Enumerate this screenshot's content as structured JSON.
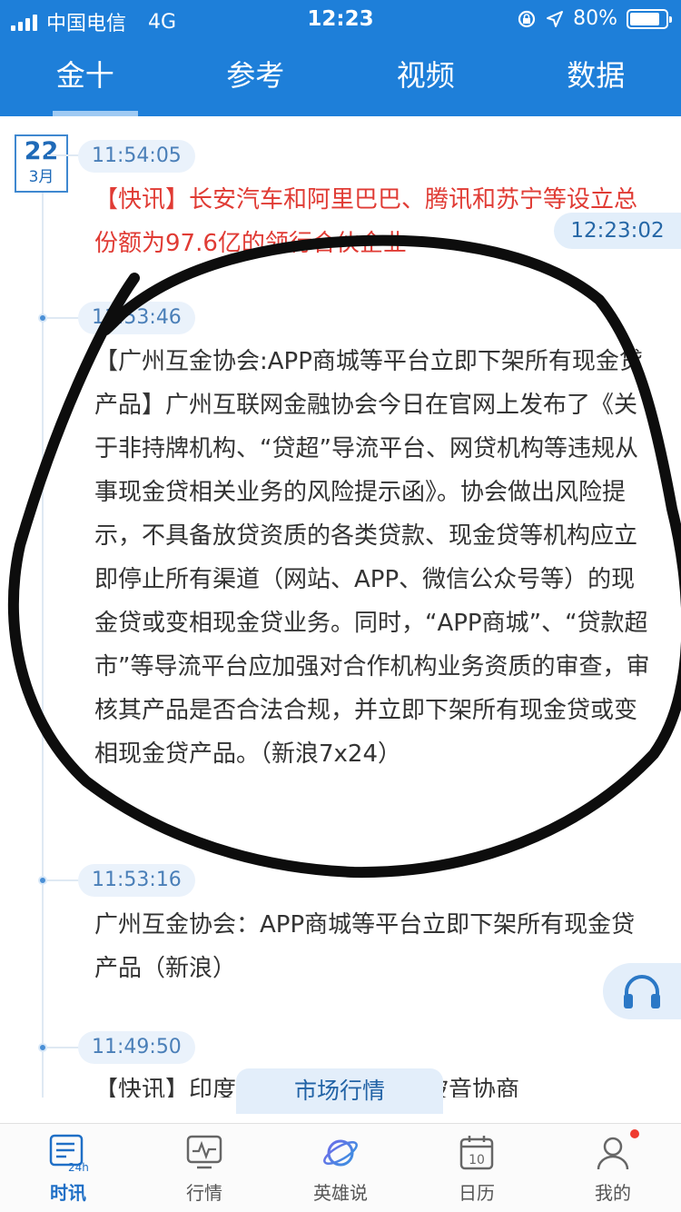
{
  "status_bar": {
    "carrier": "中国电信",
    "network": "4G",
    "time": "12:23",
    "battery": "80%"
  },
  "top_tabs": [
    {
      "label": "金十",
      "active": true
    },
    {
      "label": "参考",
      "active": false
    },
    {
      "label": "视频",
      "active": false
    },
    {
      "label": "数据",
      "active": false
    }
  ],
  "date": {
    "day": "22",
    "month": "3月"
  },
  "floating_time": "12:23:02",
  "news": [
    {
      "time": "11:54:05",
      "text": "【快讯】长安汽车和阿里巴巴、腾讯和苏宁等设立总份额为97.6亿的领行合伙企业",
      "highlight": true
    },
    {
      "time": "11:53:46",
      "text": "【广州互金协会:APP商城等平台立即下架所有现金贷产品】广州互联网金融协会今日在官网上发布了《关于非持牌机构、“贷超”导流平台、网贷机构等违规从事现金贷相关业务的风险提示函》。协会做出风险提示，不具备放贷资质的各类贷款、现金贷等机构应立即停止所有渠道（网站、APP、微信公众号等）的现金贷或变相现金贷业务。同时，“APP商城”、“贷款超市”等导流平台应加强对合作机构业务资质的审查，审核其产品是否合法合规，并立即下架所有现金贷或变相现金贷产品。（新浪7x24）",
      "highlight": false
    },
    {
      "time": "11:53:16",
      "text": "广州互金协会：APP商城等平台立即下架所有现金贷产品（新浪）",
      "highlight": false
    },
    {
      "time": "11:49:50",
      "text": "【快讯】印度与美国航空制造商波音协商",
      "highlight": false
    }
  ],
  "market_button": "市场行情",
  "bottom_nav": [
    {
      "label": "时讯",
      "icon": "news-24h-icon",
      "active": true
    },
    {
      "label": "行情",
      "icon": "market-chart-icon",
      "active": false
    },
    {
      "label": "英雄说",
      "icon": "planet-icon",
      "active": false
    },
    {
      "label": "日历",
      "icon": "calendar-icon",
      "calendar_day": "10",
      "active": false
    },
    {
      "label": "我的",
      "icon": "user-icon",
      "active": false
    }
  ],
  "colors": {
    "brand_blue": "#1e7fd9",
    "highlight_red": "#e03b34",
    "pill_bg": "#eaf2fb"
  }
}
